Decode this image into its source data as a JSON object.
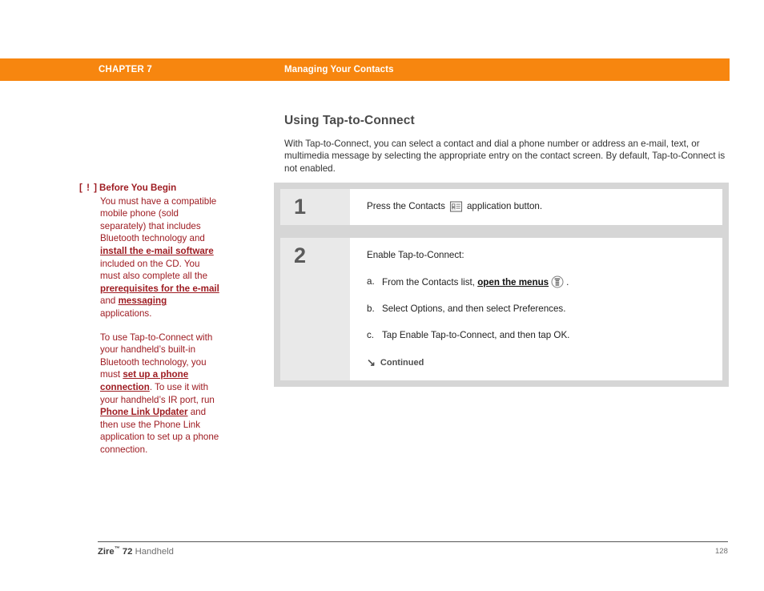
{
  "header": {
    "chapter": "CHAPTER 7",
    "title": "Managing Your Contacts",
    "bar_color": "#F7860F"
  },
  "sidebar": {
    "marker": "[ ! ]",
    "heading": "Before You Begin",
    "accent_color": "#9E1C22",
    "paragraph1": {
      "part1": "You must have a compatible mobile phone (sold separately) that includes Bluetooth technology and ",
      "link1": "install the e-mail software",
      "part2": " included on the CD. You must also complete all the ",
      "link2": "prerequisites for the e-mail",
      "part3": " and ",
      "link3": "messaging",
      "part4": " applications."
    },
    "paragraph2": {
      "part1": "To use Tap-to-Connect with your handheld’s built-in Bluetooth technology, you must ",
      "link1": "set up a phone connection",
      "part2": ". To use it with your handheld’s IR port, run ",
      "link2": "Phone Link Updater",
      "part3": " and then use the Phone Link application to set up a phone connection."
    }
  },
  "main": {
    "section_title": "Using Tap-to-Connect",
    "intro": "With Tap-to-Connect, you can select a contact and dial a phone number or address an e-mail, text, or multimedia message by selecting the appropriate entry on the contact screen. By default, Tap-to-Connect is not enabled."
  },
  "steps": [
    {
      "number": "1",
      "lead_before_icon": "Press the Contacts",
      "icon": "contacts-card-icon",
      "lead_after_icon": "application button."
    },
    {
      "number": "2",
      "lead": "Enable Tap-to-Connect:",
      "substeps": [
        {
          "letter": "a.",
          "text_before_link": "From the Contacts list, ",
          "link": "open the menus",
          "icon": "menus-icon",
          "text_after_icon": "."
        },
        {
          "letter": "b.",
          "text": "Select Options, and then select Preferences."
        },
        {
          "letter": "c.",
          "text": "Tap Enable Tap-to-Connect, and then tap OK."
        }
      ],
      "continued_arrow": "↘",
      "continued_label": "Continued"
    }
  ],
  "footer": {
    "product_bold": "Zire",
    "trademark": "™",
    "model_bold": " 72",
    "product_rest": " Handheld",
    "page_number": "128"
  }
}
